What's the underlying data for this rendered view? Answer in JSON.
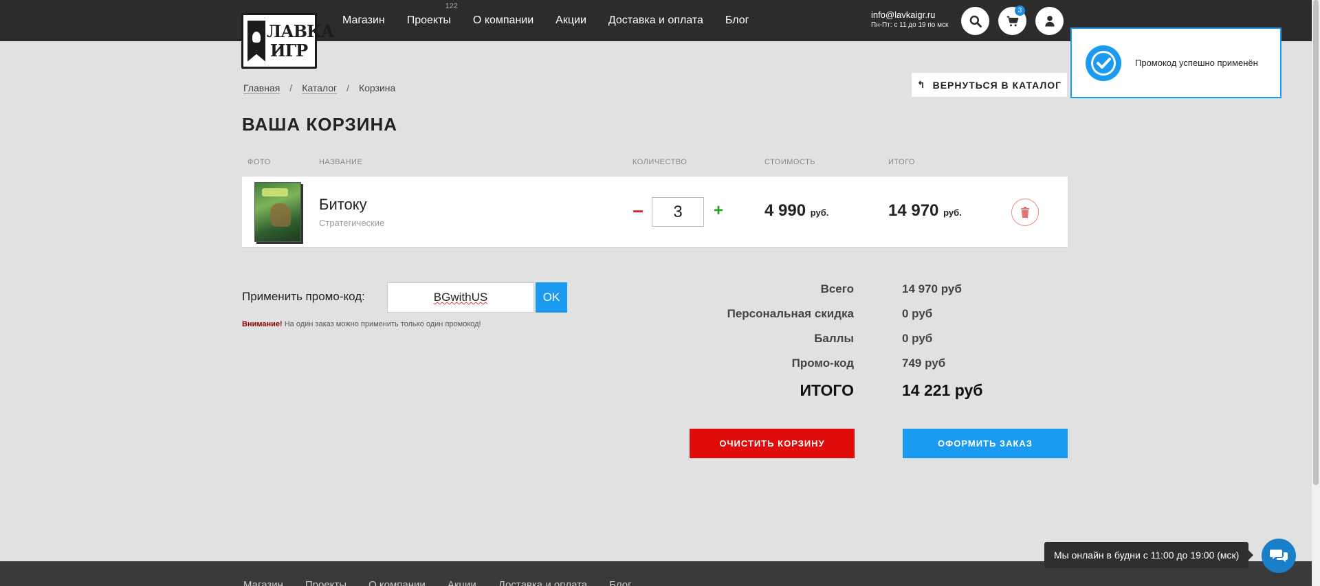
{
  "header": {
    "logo_text": "ЛАВКА ИГР",
    "nav": [
      {
        "label": "Магазин"
      },
      {
        "label": "Проекты",
        "badge": "122"
      },
      {
        "label": "О компании"
      },
      {
        "label": "Акции"
      },
      {
        "label": "Доставка и оплата"
      },
      {
        "label": "Блог"
      }
    ],
    "email": "info@lavkaigr.ru",
    "hours": "Пн-Пт: с 11 до 19 по мск",
    "cart_count": "3",
    "icons": [
      "search-icon",
      "cart-icon",
      "user-icon"
    ]
  },
  "breadcrumb": {
    "home": "Главная",
    "sep": "/",
    "catalog": "Каталог",
    "current": "Корзина"
  },
  "back_button": "ВЕРНУТЬСЯ В КАТАЛОГ",
  "page_title": "ВАША КОРЗИНА",
  "table": {
    "headers": [
      "ФОТО",
      "НАЗВАНИЕ",
      "КОЛИЧЕСТВО",
      "СТОИМОСТЬ",
      "ИТОГО"
    ],
    "items": [
      {
        "name": "Битоку",
        "category": "Стратегические",
        "quantity": "3",
        "price": "4 990",
        "price_currency": "руб.",
        "total": "14 970",
        "total_currency": "руб."
      }
    ],
    "minus": "–",
    "plus": "+"
  },
  "promo": {
    "label": "Применить промо-код:",
    "value": "BGwithUS",
    "ok": "OK",
    "note_bold": "Внимание!",
    "note_text": "На один заказ можно применить только один промокод!"
  },
  "summary": {
    "rows": [
      {
        "label": "Всего",
        "value": "14 970 руб"
      },
      {
        "label": "Персональная скидка",
        "value": "0 руб"
      },
      {
        "label": "Баллы",
        "value": "0 руб"
      },
      {
        "label": "Промо-код",
        "value": "749 руб"
      }
    ],
    "total_label": "ИТОГО",
    "total_value": "14 221 руб"
  },
  "buttons": {
    "clear": "ОЧИСТИТЬ КОРЗИНУ",
    "order": "ОФОРМИТЬ ЗАКАЗ"
  },
  "toast": {
    "message": "Промокод успешно применён"
  },
  "chat": {
    "message": "Мы онлайн в будни с 11:00 до 19:00 (мск)"
  },
  "footer": {
    "nav": [
      "Магазин",
      "Проекты",
      "О компании",
      "Акции",
      "Доставка и оплата",
      "Блог"
    ]
  },
  "colors": {
    "accent_blue": "#1a9bf0",
    "danger_red": "#e00b0b",
    "header_bg": "#2c2c2c",
    "page_bg": "#e1e1e1"
  }
}
